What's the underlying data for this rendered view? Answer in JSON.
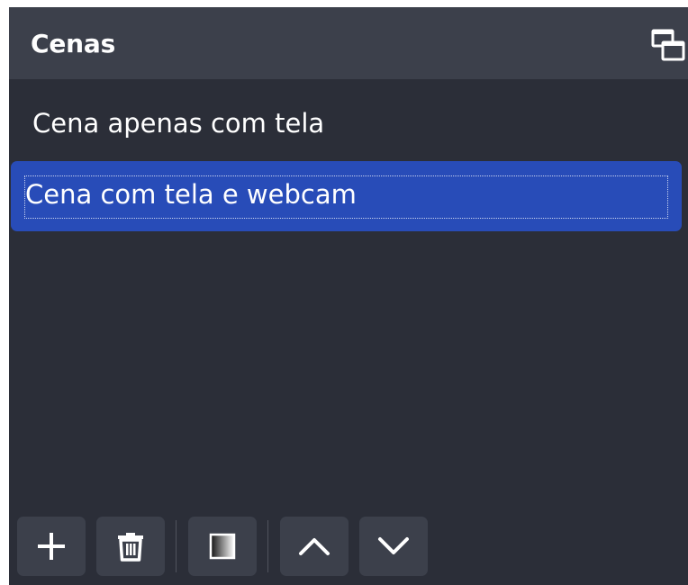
{
  "dock": {
    "title": "Cenas",
    "undock_icon": "undock-icon"
  },
  "scenes": [
    {
      "label": "Cena apenas com tela",
      "selected": false
    },
    {
      "label": "Cena com tela e webcam",
      "selected": true
    }
  ],
  "toolbar": {
    "buttons": [
      {
        "icon": "plus-icon"
      },
      {
        "icon": "trash-icon"
      },
      {
        "icon": "filters-icon"
      },
      {
        "icon": "chevron-up-icon"
      },
      {
        "icon": "chevron-down-icon"
      }
    ]
  },
  "colors": {
    "panel_bg": "#2b2e38",
    "header_bg": "#3c404b",
    "selection": "#284cb8",
    "text": "#ffffff"
  }
}
